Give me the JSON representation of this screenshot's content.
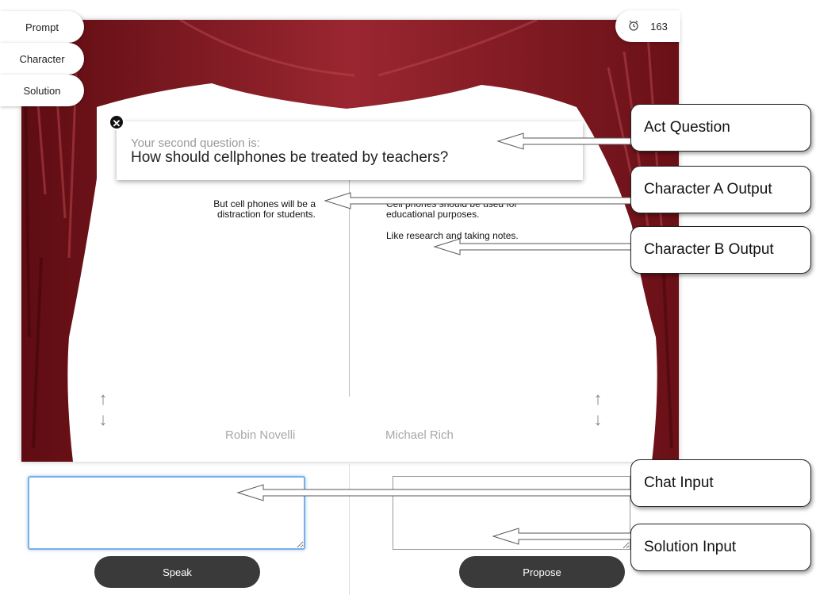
{
  "tabs": [
    "Prompt",
    "Character",
    "Solution"
  ],
  "timer": {
    "icon": "alarm-clock-icon",
    "value": "163"
  },
  "question": {
    "intro": "Your second question is:",
    "text": "How should cellphones be treated by teachers?"
  },
  "character_a": {
    "name": "Robin Novelli",
    "message": "But cell phones will be a distraction for students."
  },
  "character_b": {
    "name": "Michael Rich",
    "messages": [
      "Cell phones should be used for educational purposes.",
      "Like research and taking notes."
    ]
  },
  "chat_input": {
    "value": "",
    "placeholder": ""
  },
  "solution_input": {
    "value": "",
    "placeholder": ""
  },
  "buttons": {
    "speak": "Speak",
    "propose": "Propose"
  },
  "annotations": [
    "Act Question",
    "Character  A Output",
    "Character  B Output",
    "Chat Input",
    "Solution Input"
  ],
  "colors": {
    "curtain": "#7a141c",
    "button": "#3a3a3a",
    "chat_focus": "#7ab0e8"
  }
}
